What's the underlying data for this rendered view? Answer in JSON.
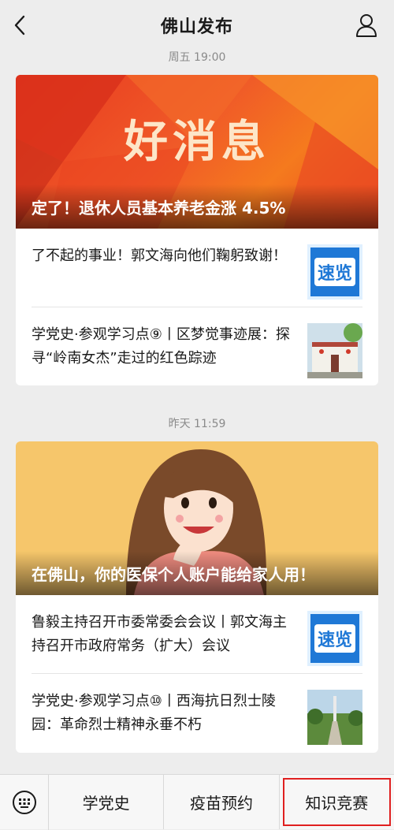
{
  "header": {
    "title": "佛山发布"
  },
  "groups": [
    {
      "time": "周五 19:00",
      "hero_big_text": "好消息",
      "hero_caption": "定了！退休人员基本养老金涨 4.5%",
      "items": [
        {
          "text": "了不起的事业！郭文海向他们鞠躬致谢！",
          "thumb_label": "速览"
        },
        {
          "text": "学党史·参观学习点⑨丨区梦觉事迹展：探寻“岭南女杰”走过的红色踪迹"
        }
      ]
    },
    {
      "time": "昨天 11:59",
      "hero_caption": "在佛山，你的医保个人账户能给家人用！",
      "items": [
        {
          "text": "鲁毅主持召开市委常委会会议丨郭文海主持召开市政府常务（扩大）会议",
          "thumb_label": "速览"
        },
        {
          "text": "学党史·参观学习点⑩丨西海抗日烈士陵园：革命烈士精神永垂不朽"
        }
      ]
    }
  ],
  "bottom_menu": [
    {
      "label": "学党史"
    },
    {
      "label": "疫苗预约"
    },
    {
      "label": "知识竞赛"
    }
  ],
  "colors": {
    "accent_red": "#e02020",
    "wechat_bg": "#ededed"
  }
}
